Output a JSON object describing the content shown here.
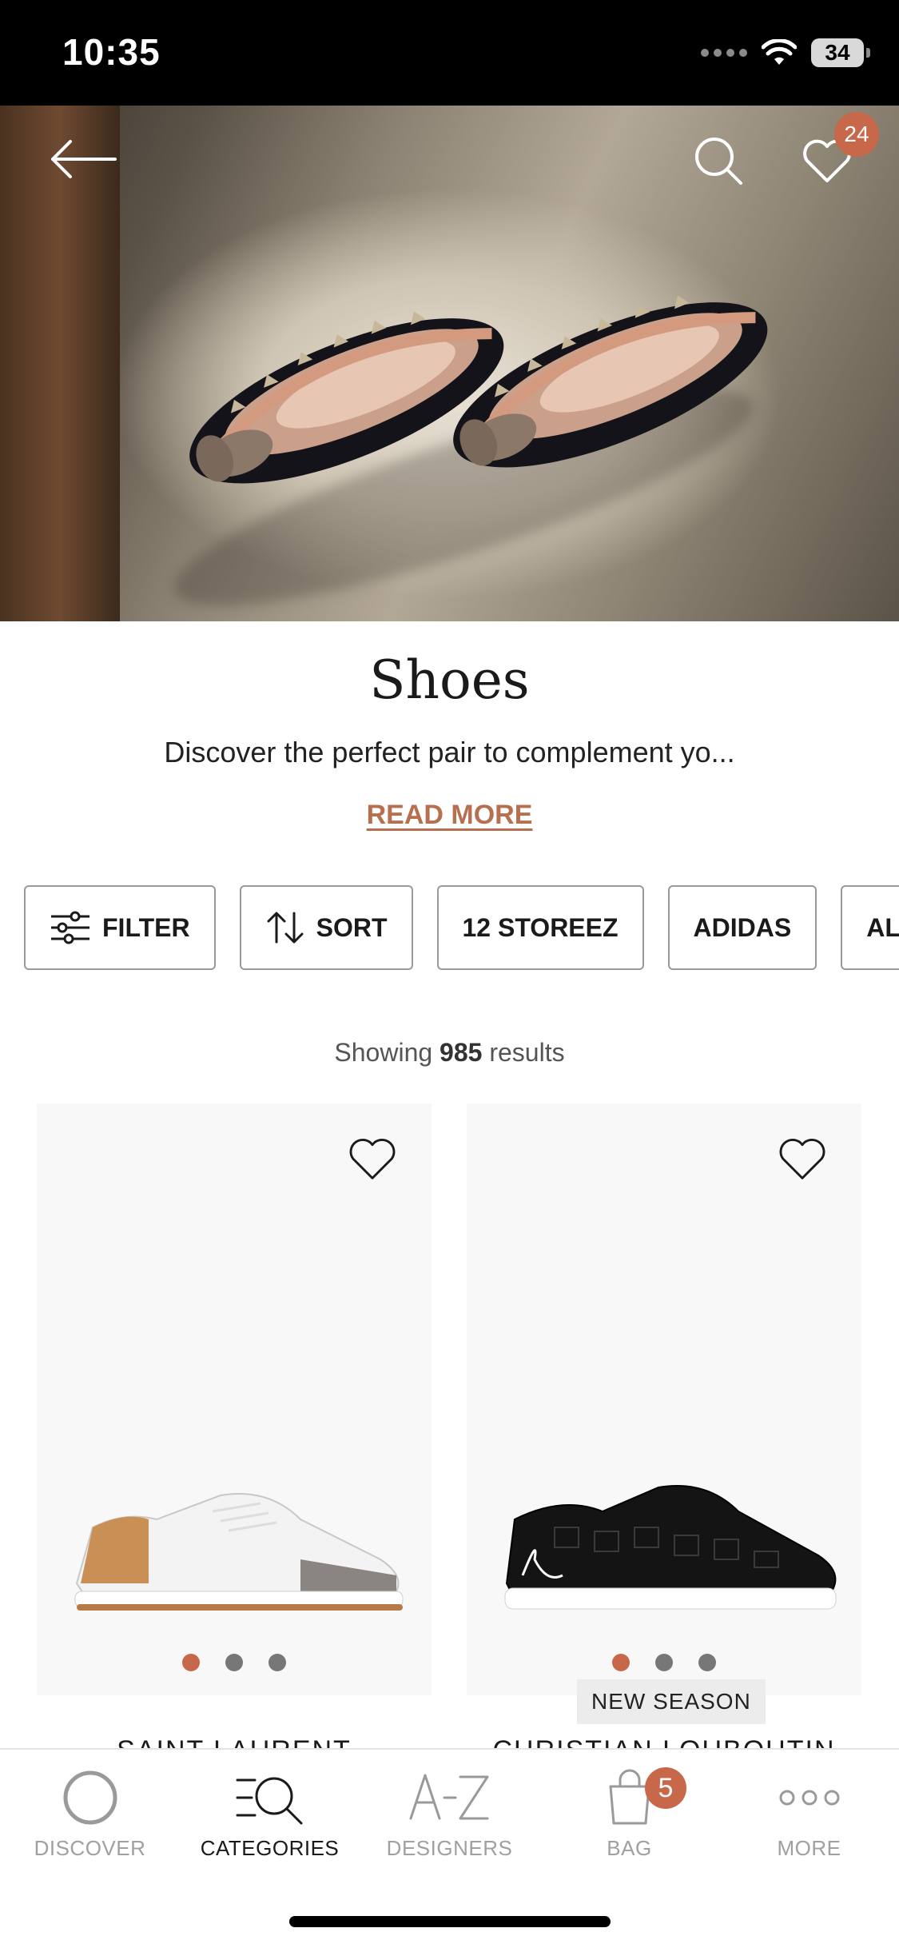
{
  "status_bar": {
    "time": "10:35",
    "battery": "34"
  },
  "header": {
    "wishlist_count": "24"
  },
  "category": {
    "title": "Shoes",
    "description": "Discover the perfect pair to complement yo...",
    "read_more": "READ MORE"
  },
  "chips": [
    {
      "label": "FILTER",
      "icon": "filter-icon"
    },
    {
      "label": "SORT",
      "icon": "sort-icon"
    },
    {
      "label": "12 STOREEZ"
    },
    {
      "label": "ADIDAS"
    },
    {
      "label": "AL"
    }
  ],
  "results": {
    "prefix": "Showing",
    "count": "985",
    "suffix": "results"
  },
  "products": [
    {
      "brand": "SAINT LAURENT",
      "badge": "",
      "image_count": 3,
      "active_image": 1
    },
    {
      "brand": "CHRISTIAN LOUBOUTIN",
      "badge": "NEW SEASON",
      "image_count": 3,
      "active_image": 1
    }
  ],
  "tabbar": {
    "items": [
      {
        "label": "DISCOVER",
        "icon": "discover-icon"
      },
      {
        "label": "CATEGORIES",
        "icon": "categories-icon"
      },
      {
        "label": "DESIGNERS",
        "icon": "designers-icon"
      },
      {
        "label": "BAG",
        "icon": "bag-icon",
        "badge": "5"
      },
      {
        "label": "MORE",
        "icon": "more-icon"
      }
    ],
    "active": "CATEGORIES"
  },
  "colors": {
    "accent": "#c8684a",
    "link": "#b7704f"
  }
}
